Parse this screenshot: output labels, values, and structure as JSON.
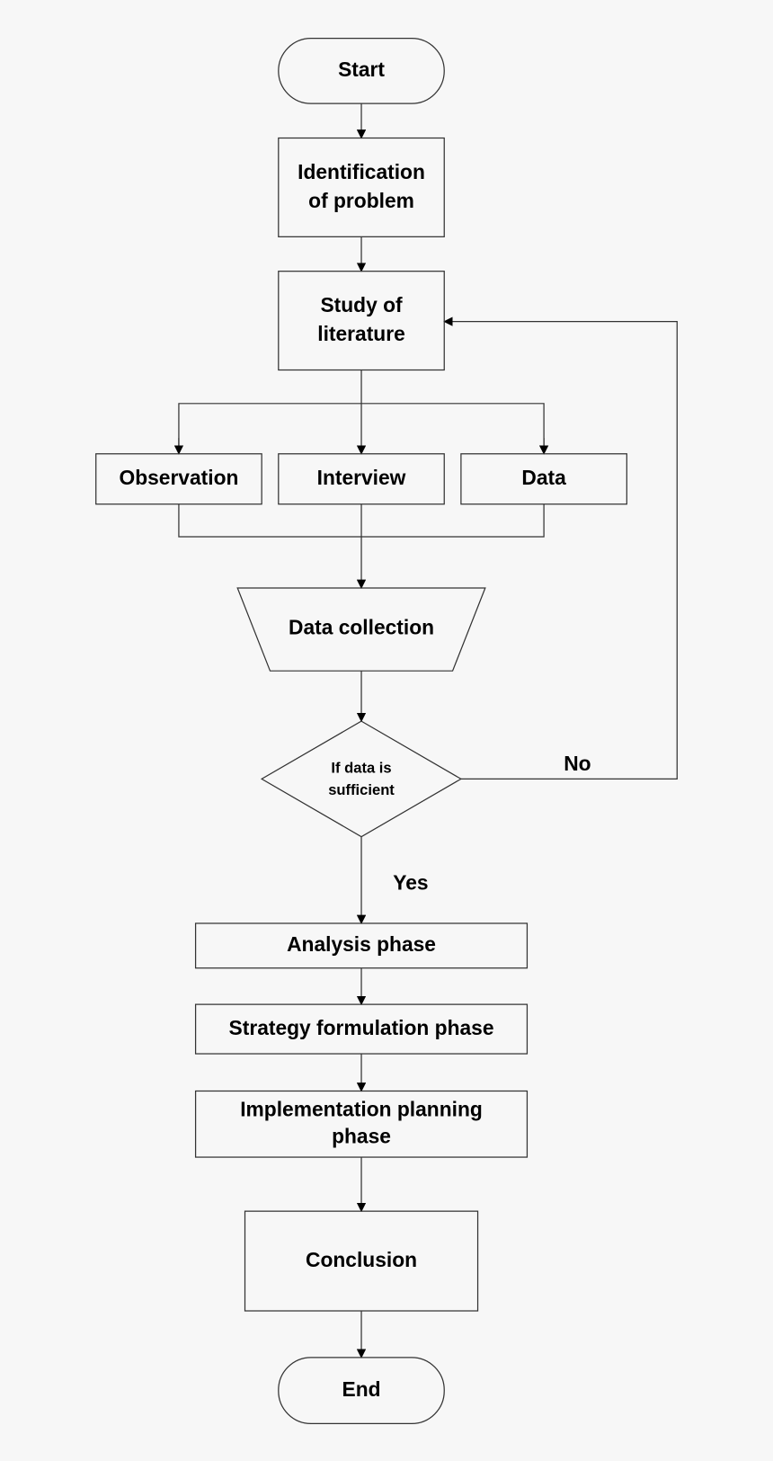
{
  "nodes": {
    "start": "Start",
    "identification": [
      "Identification",
      "of problem"
    ],
    "study": [
      "Study of",
      "literature"
    ],
    "observation": "Observation",
    "interview": "Interview",
    "data": "Data",
    "data_collection": "Data collection",
    "decision": [
      "If data is",
      "sufficient"
    ],
    "analysis": "Analysis phase",
    "strategy": "Strategy formulation phase",
    "implementation": [
      "Implementation planning",
      "phase"
    ],
    "conclusion": "Conclusion",
    "end": "End"
  },
  "edges": {
    "no_label": "No",
    "yes_label": "Yes"
  }
}
